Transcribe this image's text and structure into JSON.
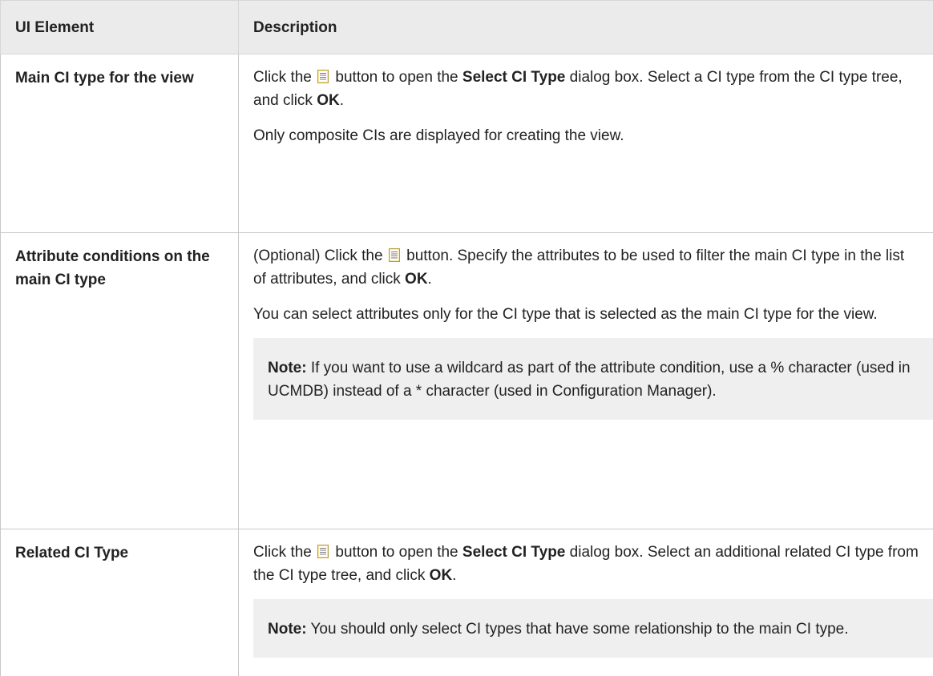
{
  "header": {
    "col1": "UI Element",
    "col2": "Description"
  },
  "rows": [
    {
      "element": "Main CI type for the view",
      "p1_a": "Click the",
      "p1_b": "button to open the",
      "p1_bold1": "Select CI Type",
      "p1_c": "dialog box. Select a CI type from the CI type tree, and click",
      "p1_bold2": "OK",
      "p1_d": ".",
      "p2": "Only composite CIs are displayed for creating the view."
    },
    {
      "element": "Attribute conditions on the main CI type",
      "p1_a": "(Optional) Click the",
      "p1_b": "button. Specify the attributes to be used to filter the main CI type in the list of attributes, and click",
      "p1_bold": "OK",
      "p1_c": ".",
      "p2": "You can select attributes only for the CI type that is selected as the main CI type for the view.",
      "note_label": "Note:",
      "note_text": "If you want to use a wildcard as part of the attribute condition, use a % character (used in UCMDB) instead of a * character (used in Configuration Manager)."
    },
    {
      "element": "Related CI Type",
      "p1_a": "Click the",
      "p1_b": "button to open the",
      "p1_bold1": "Select CI Type",
      "p1_c": "dialog box. Select an additional related CI type from the CI type tree, and click",
      "p1_bold2": "OK",
      "p1_d": ".",
      "note_label": "Note:",
      "note_text": "You should only select CI types that have some relationship to the main CI type."
    }
  ],
  "icons": {
    "button_icon": "list-button-icon"
  }
}
